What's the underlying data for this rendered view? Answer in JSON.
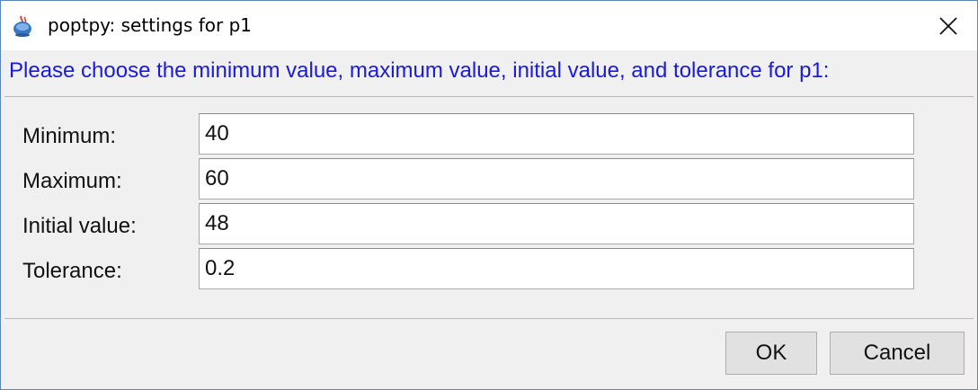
{
  "window": {
    "title": "poptpy: settings for p1",
    "app_icon": "java-cup-icon",
    "close_icon": "close-x-icon"
  },
  "prompt": "Please choose the minimum value, maximum value, initial value, and tolerance for p1:",
  "fields": [
    {
      "label": "Minimum:",
      "value": "40"
    },
    {
      "label": "Maximum:",
      "value": "60"
    },
    {
      "label": "Initial value:",
      "value": "48"
    },
    {
      "label": "Tolerance:",
      "value": "0.2"
    }
  ],
  "buttons": {
    "ok_label": "OK",
    "cancel_label": "Cancel"
  },
  "colors": {
    "prompt_text": "#1a1adc",
    "window_border": "#5b86b8",
    "dialog_background": "#f0f0f0"
  }
}
